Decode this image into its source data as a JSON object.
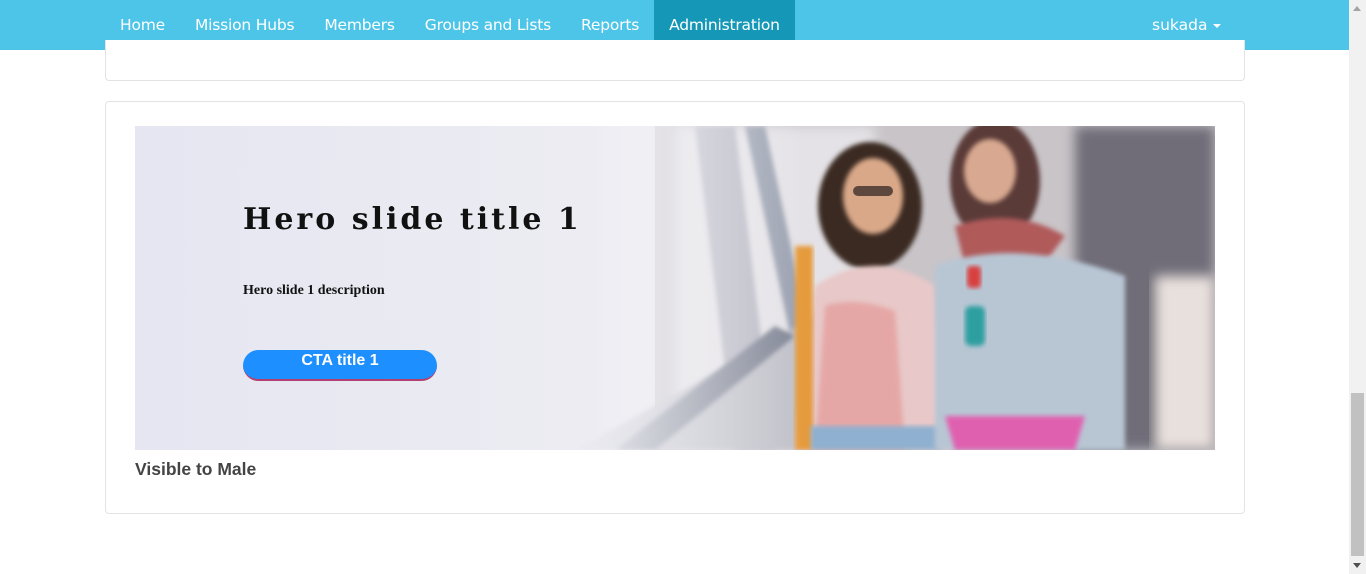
{
  "nav": {
    "items": [
      {
        "label": "Home",
        "active": false
      },
      {
        "label": "Mission Hubs",
        "active": false
      },
      {
        "label": "Members",
        "active": false
      },
      {
        "label": "Groups and Lists",
        "active": false
      },
      {
        "label": "Reports",
        "active": false
      },
      {
        "label": "Administration",
        "active": true
      }
    ],
    "user": {
      "name": "sukada",
      "icon": "caret-down-icon"
    }
  },
  "hero": {
    "title": "Hero slide title 1",
    "description": "Hero slide 1 description",
    "cta_label": "CTA title 1"
  },
  "panel": {
    "visibility_label": "Visible to Male"
  },
  "colors": {
    "navbar": "#4dc5e8",
    "nav_active": "#1598b8",
    "cta": "#1e8fff"
  }
}
